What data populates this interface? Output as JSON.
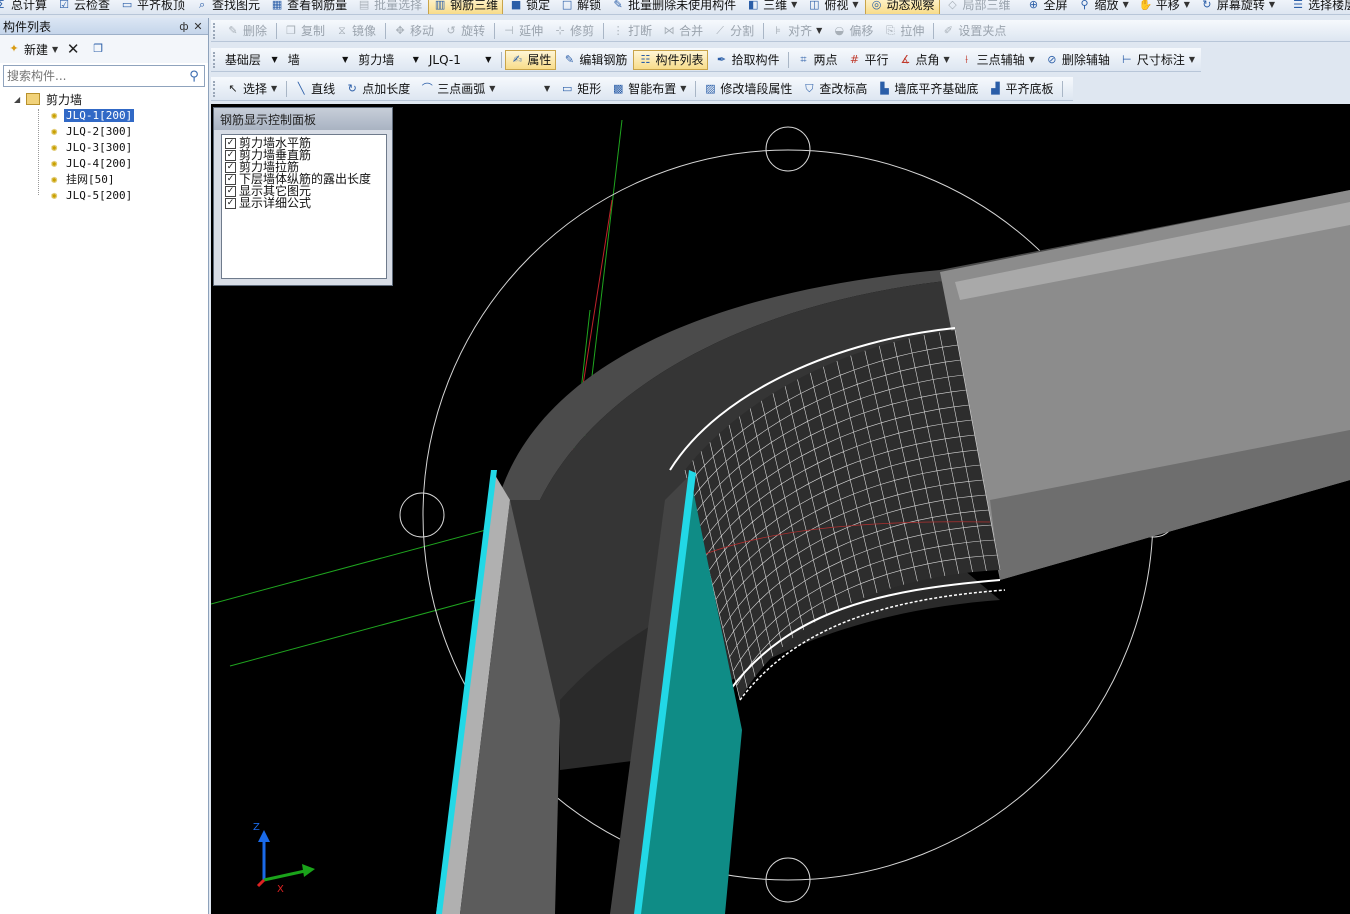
{
  "toolbar1": {
    "items": [
      {
        "label": "总计算",
        "icon": "calculate-icon"
      },
      {
        "label": "云检查",
        "icon": "cloud-check-icon"
      },
      {
        "label": "平齐板顶",
        "icon": "align-slab-top-icon"
      },
      {
        "label": "查找图元",
        "icon": "find-element-icon"
      },
      {
        "label": "查看钢筋量",
        "icon": "view-rebar-quantity-icon"
      },
      {
        "label": "批量选择",
        "icon": "batch-select-icon"
      },
      {
        "label": "钢筋三维",
        "icon": "rebar-3d-icon"
      },
      {
        "label": "锁定",
        "icon": "lock-icon"
      },
      {
        "label": "解锁",
        "icon": "unlock-icon"
      },
      {
        "label": "批量删除未使用构件",
        "icon": "batch-delete-icon"
      },
      {
        "label": "三维",
        "icon": "3d-view-icon"
      },
      {
        "label": "俯视",
        "icon": "top-view-icon"
      },
      {
        "label": "动态观察",
        "icon": "orbit-icon"
      },
      {
        "label": "局部三维",
        "icon": "partial-3d-icon"
      },
      {
        "label": "全屏",
        "icon": "fullscreen-icon"
      },
      {
        "label": "缩放",
        "icon": "zoom-icon"
      },
      {
        "label": "平移",
        "icon": "pan-icon"
      },
      {
        "label": "屏幕旋转",
        "icon": "screen-rotate-icon"
      },
      {
        "label": "选择楼层",
        "icon": "select-floor-icon"
      }
    ]
  },
  "toolbar2": {
    "items": [
      {
        "label": "删除",
        "icon": "delete-icon"
      },
      {
        "label": "复制",
        "icon": "copy-icon"
      },
      {
        "label": "镜像",
        "icon": "mirror-icon"
      },
      {
        "label": "移动",
        "icon": "move-icon"
      },
      {
        "label": "旋转",
        "icon": "rotate-icon"
      },
      {
        "label": "延伸",
        "icon": "extend-icon"
      },
      {
        "label": "修剪",
        "icon": "trim-icon"
      },
      {
        "label": "打断",
        "icon": "break-icon"
      },
      {
        "label": "合并",
        "icon": "merge-icon"
      },
      {
        "label": "分割",
        "icon": "split-icon"
      },
      {
        "label": "对齐",
        "icon": "align-icon"
      },
      {
        "label": "偏移",
        "icon": "offset-icon"
      },
      {
        "label": "拉伸",
        "icon": "stretch-icon"
      },
      {
        "label": "设置夹点",
        "icon": "set-grip-icon"
      }
    ]
  },
  "toolbar3": {
    "floor": "基础层",
    "category": "墙",
    "type": "剪力墙",
    "component": "JLQ-1",
    "items": [
      {
        "label": "属性",
        "icon": "properties-icon"
      },
      {
        "label": "编辑钢筋",
        "icon": "edit-rebar-icon"
      },
      {
        "label": "构件列表",
        "icon": "component-list-icon"
      },
      {
        "label": "拾取构件",
        "icon": "pick-component-icon"
      },
      {
        "label": "两点",
        "icon": "two-point-axis-icon"
      },
      {
        "label": "平行",
        "icon": "parallel-axis-icon"
      },
      {
        "label": "点角",
        "icon": "point-angle-axis-icon"
      },
      {
        "label": "三点辅轴",
        "icon": "three-point-axis-icon"
      },
      {
        "label": "删除辅轴",
        "icon": "delete-axis-icon"
      },
      {
        "label": "尺寸标注",
        "icon": "dimension-icon"
      }
    ]
  },
  "toolbar4": {
    "items": [
      {
        "label": "选择",
        "icon": "select-cursor-icon"
      },
      {
        "label": "直线",
        "icon": "line-icon"
      },
      {
        "label": "点加长度",
        "icon": "point-length-icon"
      },
      {
        "label": "三点画弧",
        "icon": "three-point-arc-icon"
      },
      {
        "label": "矩形",
        "icon": "rectangle-icon"
      },
      {
        "label": "智能布置",
        "icon": "smart-layout-icon"
      },
      {
        "label": "修改墙段属性",
        "icon": "modify-wall-icon"
      },
      {
        "label": "查改标高",
        "icon": "check-elevation-icon"
      },
      {
        "label": "墙底平齐基础底",
        "icon": "wall-bottom-align-icon"
      },
      {
        "label": "平齐底板",
        "icon": "align-bottom-slab-icon"
      }
    ]
  },
  "left_panel": {
    "title": "构件列表",
    "pin": "ф",
    "close": "✕",
    "new_label": "新建",
    "search_placeholder": "搜索构件...",
    "tree": {
      "root": "剪力墙",
      "children": [
        "JLQ-1[200]",
        "JLQ-2[300]",
        "JLQ-3[300]",
        "JLQ-4[200]",
        "挂网[50]",
        "JLQ-5[200]"
      ],
      "selected_index": 0
    }
  },
  "rebar_panel": {
    "title": "钢筋显示控制面板",
    "options": [
      {
        "label": "剪力墙水平筋",
        "checked": true
      },
      {
        "label": "剪力墙垂直筋",
        "checked": true
      },
      {
        "label": "剪力墙拉筋",
        "checked": true
      },
      {
        "label": "下层墙体纵筋的露出长度",
        "checked": true
      },
      {
        "label": "显示其它图元",
        "checked": true
      },
      {
        "label": "显示详细公式",
        "checked": true
      }
    ]
  },
  "axes": {
    "z": "Z",
    "x": "X"
  },
  "colors": {
    "viewport_bg": "#000000",
    "wall_gray": "#5a5a5a",
    "wall_teal": "#0f8c86",
    "edge_cyan": "#22d8e6",
    "toolbar_active": "#f8dc8a",
    "selection": "#3169c6"
  }
}
